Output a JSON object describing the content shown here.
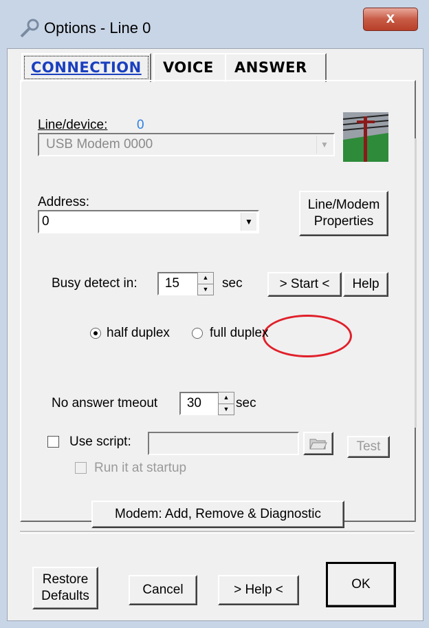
{
  "window": {
    "title": "Options - Line 0",
    "close_label": "x"
  },
  "tabs": [
    {
      "label": "CONNECTION",
      "active": true
    },
    {
      "label": "VOICE",
      "active": false
    },
    {
      "label": "ANSWER",
      "active": false
    }
  ],
  "connection": {
    "line_device_label": "Line/device:",
    "line_device_number": "0",
    "line_device_value": "USB Modem 0000",
    "address_label": "Address:",
    "address_value": "0",
    "line_modem_properties_label": "Line/Modem Properties",
    "busy_detect_label": "Busy detect in:",
    "busy_detect_value": "15",
    "busy_detect_unit": "sec",
    "start_label": "> Start <",
    "help_label": "Help",
    "duplex_options": [
      {
        "label": "half duplex",
        "selected": true
      },
      {
        "label": "full duplex",
        "selected": false
      }
    ],
    "no_answer_label": "No answer tmeout",
    "no_answer_value": "30",
    "no_answer_unit": "sec",
    "use_script_label": "Use script:",
    "use_script_checked": false,
    "script_value": "",
    "test_label": "Test",
    "run_at_startup_label": "Run it at startup",
    "run_at_startup_checked": false,
    "modem_button_label": "Modem: Add, Remove & Diagnostic"
  },
  "footer": {
    "restore_defaults_label": "Restore Defaults",
    "cancel_label": "Cancel",
    "help_label": "> Help <",
    "ok_label": "OK"
  },
  "colors": {
    "active_tab": "#1a3fbf",
    "annotation_circle": "#e0202a",
    "device_number": "#2f7fe0"
  }
}
